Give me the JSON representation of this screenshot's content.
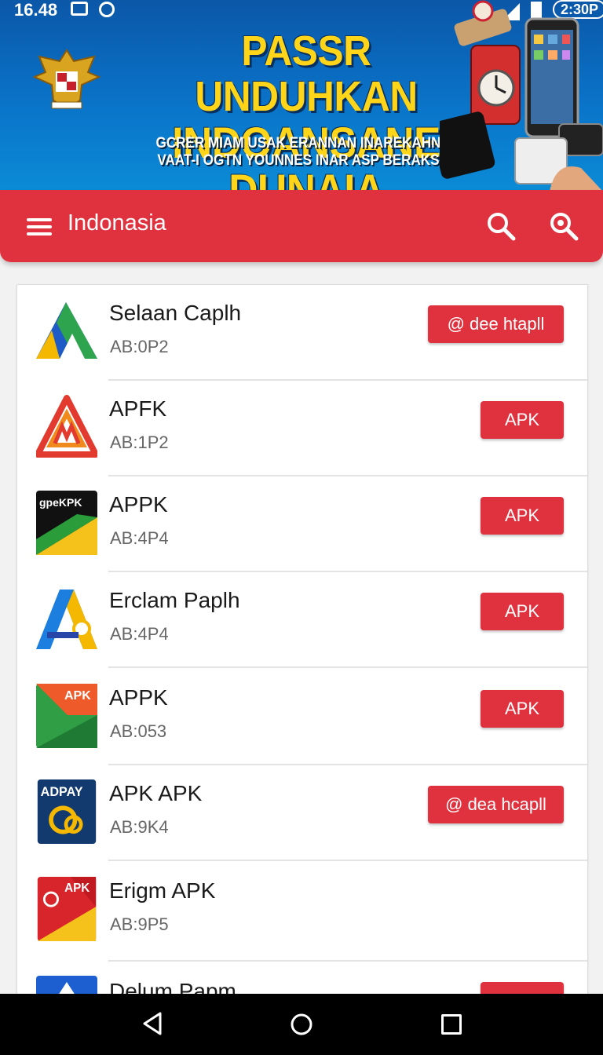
{
  "status_bar": {
    "time": "16.48",
    "clock_badge": "2:30P"
  },
  "banner": {
    "headline_line1": "PASSR UNDUHKAN",
    "headline_line2": "INDOANSANE DUNAIA",
    "subline_line1": "GCRER MIAM USAK ERANNAN INAREKAHN",
    "subline_line2": "VAAT-I OGTN YOUNNES INAR ASP BERAKS"
  },
  "appbar": {
    "title": "Indonasia"
  },
  "apps": [
    {
      "name": "Selaan Caplh",
      "code": "AB:0P2",
      "button": "@ dee htapll"
    },
    {
      "name": "APFK",
      "code": "AB:1P2",
      "button": "APK"
    },
    {
      "name": "APPK",
      "code": "AB:4P4",
      "button": "APK",
      "icon_text": "gpeKPK"
    },
    {
      "name": "Erclam Paplh",
      "code": "AB:4P4",
      "button": "APK"
    },
    {
      "name": "APPK",
      "code": "AB:053",
      "button": "APK",
      "icon_text": "APK"
    },
    {
      "name": "APK APK",
      "code": "AB:9K4",
      "button": "@ dea hcapll",
      "icon_text": "ADPAY"
    },
    {
      "name": "Erigm APK",
      "code": "AB:9P5",
      "button": "",
      "icon_text": "APK"
    },
    {
      "name": "Delum Papm",
      "code": "",
      "button": ""
    }
  ],
  "colors": {
    "accent": "#e0323e",
    "banner_blue": "#0a74c9",
    "headline_yellow": "#ffd51a"
  }
}
